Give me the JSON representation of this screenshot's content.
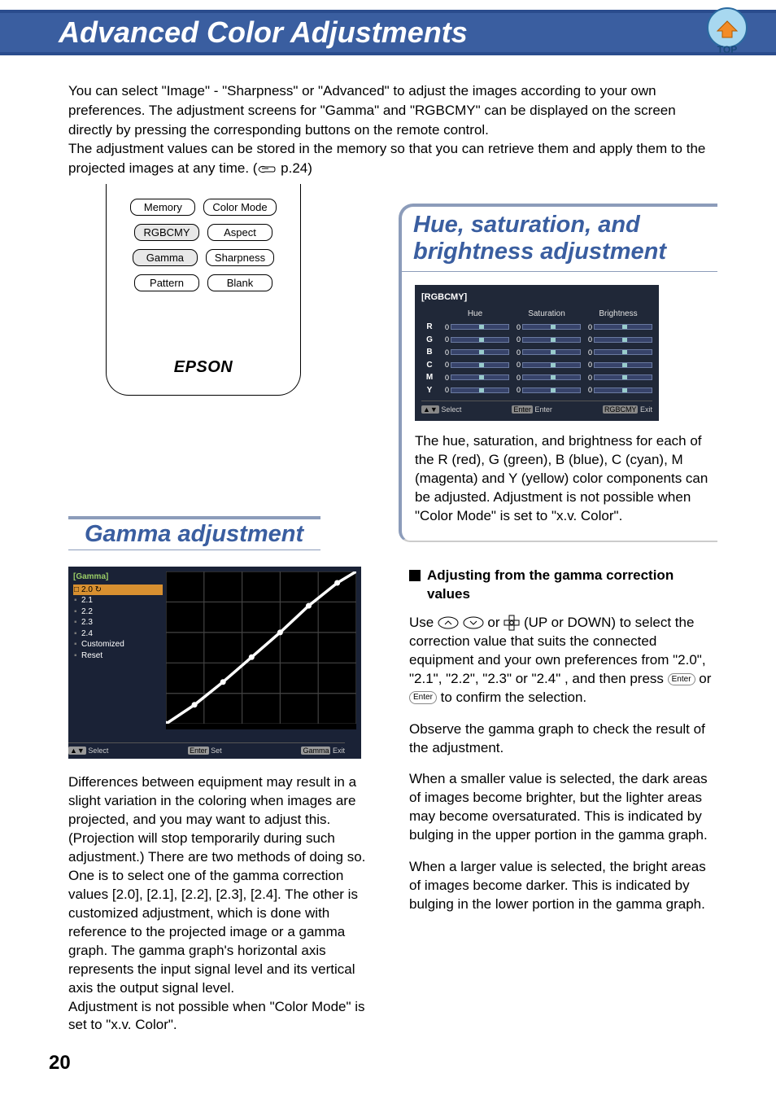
{
  "header": {
    "title": "Advanced Color Adjustments",
    "top_label": "TOP"
  },
  "intro": {
    "p1": "You can select \"Image\" - \"Sharpness\" or \"Advanced\" to adjust the images according to your own preferences. The adjustment screens for \"Gamma\" and \"RGBCMY\" can be displayed on the screen directly by pressing the corresponding buttons on the remote control.",
    "p2a": "The adjustment values can be stored in the memory so that you can retrieve them and apply them to the projected images at any time. (",
    "p2b": " p.24)"
  },
  "remote": {
    "memory": "Memory",
    "colormode": "Color Mode",
    "rgbcmy": "RGBCMY",
    "aspect": "Aspect",
    "gamma": "Gamma",
    "sharpness": "Sharpness",
    "pattern": "Pattern",
    "blank": "Blank",
    "logo": "EPSON"
  },
  "hsb": {
    "title": "Hue, saturation, and brightness adjustment",
    "osd_title": "[RGBCMY]",
    "cols": {
      "hue": "Hue",
      "sat": "Saturation",
      "bri": "Brightness"
    },
    "channels": [
      "R",
      "G",
      "B",
      "C",
      "M",
      "Y"
    ],
    "slider_zero": "0",
    "footer_select": "Select",
    "footer_enter": "Enter",
    "footer_exit": "Exit",
    "footer_select_key": "▲▼",
    "footer_enter_key": "Enter",
    "footer_exit_key": "RGBCMY",
    "body": "The hue, saturation, and brightness for each of the R (red), G (green), B (blue), C (cyan), M (magenta) and Y (yellow) color components can be adjusted. Adjustment is not possible when \"Color Mode\" is set to \"x.v. Color\"."
  },
  "gamma": {
    "title": "Gamma adjustment",
    "osd_title": "[Gamma]",
    "items": [
      "2.0",
      "2.1",
      "2.2",
      "2.3",
      "2.4",
      "Customized",
      "Reset"
    ],
    "footer_select": "Select",
    "footer_set": "Set",
    "footer_exit": "Exit",
    "footer_select_key": "▲▼",
    "footer_set_key": "Enter",
    "footer_exit_key": "Gamma",
    "leftbody": "Differences between equipment may result in a slight variation in the coloring when images are projected, and you may want to adjust this. (Projection will stop temporarily during such adjustment.) There are two methods of doing so. One is to select one of the gamma correction values [2.0], [2.1], [2.2], [2.3], [2.4]. The other is customized adjustment, which is done with reference to the projected image or a gamma graph. The gamma graph's horizontal axis represents the input signal level and its vertical axis the output signal level.",
    "leftbody2": "Adjustment is not possible when \"Color Mode\" is set to \"x.v. Color\".",
    "subhead": "Adjusting from the gamma correction values",
    "r_p1a": "Use ",
    "r_p1b": " or ",
    "r_p1c": " (UP or DOWN) to select the correction value that suits the connected equipment and your own preferences from \"2.0\", \"2.1\", \"2.2\", \"2.3\" or \"2.4\" , and then press ",
    "r_p1d": " or ",
    "r_p1e": " to confirm the selection.",
    "r_p2": "Observe the gamma graph to check the result of the adjustment.",
    "r_p3": "When a smaller value is selected, the dark areas of images become brighter, but the lighter areas may become oversaturated. This is indicated by bulging in the upper portion in the gamma graph.",
    "r_p4": "When a larger value is selected, the bright areas of images become darker. This is indicated by bulging in the lower portion in the gamma graph.",
    "enter_label": "Enter"
  },
  "page_no": "20"
}
